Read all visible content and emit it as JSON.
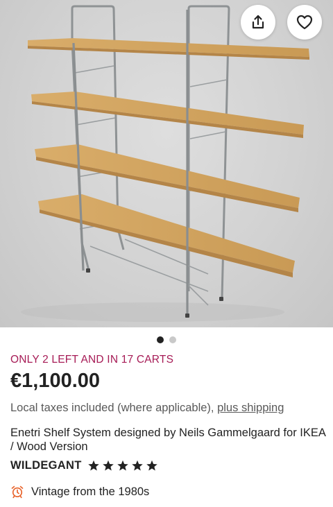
{
  "listing": {
    "image_alt": "Enetri Shelf System photo",
    "stock_notice": "ONLY 2 LEFT AND IN 17 CARTS",
    "price": "€1,100.00",
    "tax_text": "Local taxes included (where applicable), ",
    "shipping_link": "plus shipping",
    "title": "Enetri Shelf System designed by Neils Gammelgaard for IKEA / Wood Version",
    "seller": "WILDEGANT",
    "rating_stars": 5,
    "vintage_text": "Vintage from the 1980s"
  },
  "carousel": {
    "total": 2,
    "active_index": 0
  },
  "icons": {
    "share": "share-icon",
    "favorite": "heart-icon",
    "star": "star-icon",
    "vintage": "alarm-clock-icon"
  },
  "colors": {
    "stock_notice": "#a61a55",
    "vintage_icon": "#e8632b",
    "stars": "#222222"
  }
}
